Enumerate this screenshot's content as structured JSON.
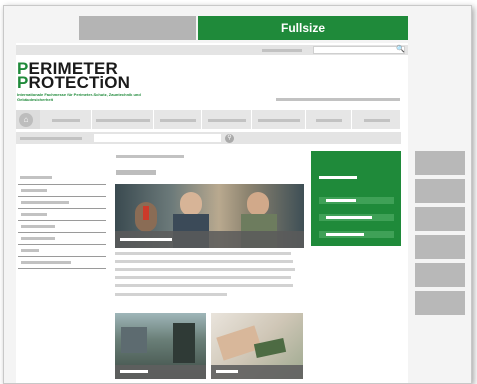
{
  "view_tabs": {
    "mobile_label": "",
    "fullsize_label": "Fullsize"
  },
  "logo": {
    "line1_initial": "P",
    "line1_rest": "ERIMETER",
    "line2_initial": "P",
    "line2_rest": "ROTECTiON",
    "tagline": "Internationale Fachmesse für Perimeter-Schutz, Zauntechnik und Gebäudesicherheit"
  },
  "icons": {
    "search": "search-icon",
    "home": "home-icon",
    "subsearch": "magnifier-icon"
  },
  "colors": {
    "brand_green": "#1f8a3a",
    "placeholder_gray": "#c2c2c2"
  }
}
